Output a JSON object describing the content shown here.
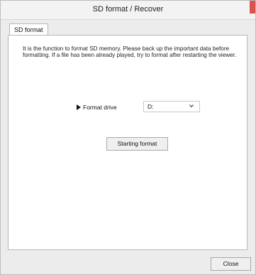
{
  "window": {
    "title": "SD format / Recover"
  },
  "tabs": [
    {
      "label": "SD format",
      "active": true
    }
  ],
  "panel": {
    "description": "It is the function to format SD memory.  Please back up the important data before formatting.  If a file has been already played, try to format after restarting the viewer.",
    "format_drive_label": "Format drive",
    "drive_select": {
      "selected": "D:"
    },
    "start_button_label": "Starting format"
  },
  "footer": {
    "close_button_label": "Close"
  },
  "icons": {
    "format_arrow": "right-triangle-icon",
    "dropdown": "chevron-down-icon",
    "title_close": "close-icon"
  },
  "colors": {
    "title_close_accent": "#d9534f",
    "window_bg": "#ececec",
    "panel_bg": "#ffffff"
  }
}
